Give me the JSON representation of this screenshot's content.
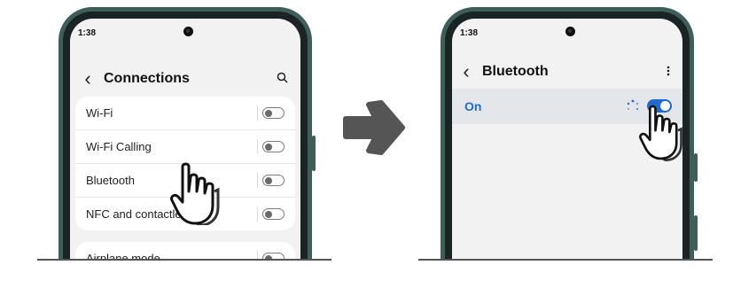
{
  "left_phone": {
    "status_time": "1:38",
    "header": {
      "title": "Connections",
      "back_icon": "chevron-left-icon",
      "action_icon": "search-icon"
    },
    "rows": [
      {
        "label": "Wi-Fi",
        "state": "off"
      },
      {
        "label": "Wi-Fi Calling",
        "state": "off"
      },
      {
        "label": "Bluetooth",
        "state": "off"
      },
      {
        "label": "NFC and contactless p",
        "state": "off"
      }
    ],
    "airplane": {
      "label": "Airplane mode",
      "state": "off"
    }
  },
  "right_phone": {
    "status_time": "1:38",
    "header": {
      "title": "Bluetooth",
      "back_icon": "chevron-left-icon",
      "action_icon": "more-vertical-icon"
    },
    "on_row": {
      "label": "On",
      "state": "on"
    }
  },
  "colors": {
    "accent": "#1f6bd0",
    "frame": "#3f5e57",
    "arrow": "#555555"
  }
}
